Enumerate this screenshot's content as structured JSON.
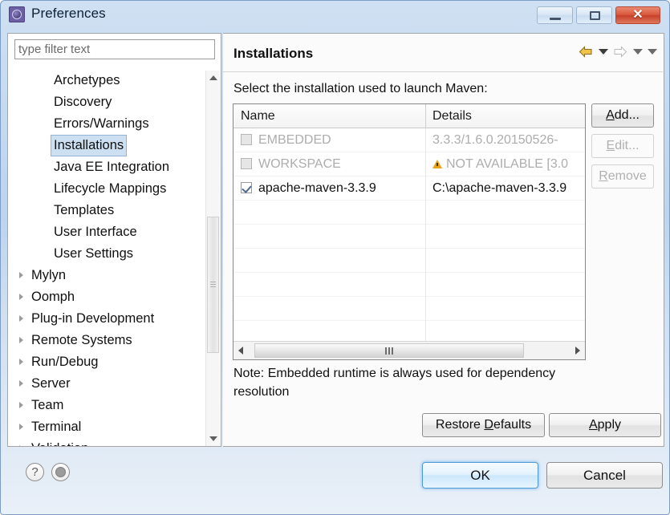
{
  "window": {
    "title": "Preferences",
    "icon": "preferences-gear-icon",
    "controls": {
      "minimize": "minimize-icon",
      "maximize": "maximize-icon",
      "close": "✕"
    }
  },
  "sidebar": {
    "filter": {
      "placeholder": "type filter text",
      "value": ""
    },
    "items": [
      {
        "label": "Archetypes",
        "type": "leaf",
        "selected": false
      },
      {
        "label": "Discovery",
        "type": "leaf",
        "selected": false
      },
      {
        "label": "Errors/Warnings",
        "type": "leaf",
        "selected": false
      },
      {
        "label": "Installations",
        "type": "leaf",
        "selected": true
      },
      {
        "label": "Java EE Integration",
        "type": "leaf",
        "selected": false
      },
      {
        "label": "Lifecycle Mappings",
        "type": "leaf",
        "selected": false
      },
      {
        "label": "Templates",
        "type": "leaf",
        "selected": false
      },
      {
        "label": "User Interface",
        "type": "leaf",
        "selected": false
      },
      {
        "label": "User Settings",
        "type": "leaf",
        "selected": false
      },
      {
        "label": "Mylyn",
        "type": "node",
        "selected": false
      },
      {
        "label": "Oomph",
        "type": "node",
        "selected": false
      },
      {
        "label": "Plug-in Development",
        "type": "node",
        "selected": false
      },
      {
        "label": "Remote Systems",
        "type": "node",
        "selected": false
      },
      {
        "label": "Run/Debug",
        "type": "node",
        "selected": false
      },
      {
        "label": "Server",
        "type": "node",
        "selected": false
      },
      {
        "label": "Team",
        "type": "node",
        "selected": false
      },
      {
        "label": "Terminal",
        "type": "node",
        "selected": false
      },
      {
        "label": "Validation",
        "type": "node",
        "selected": false
      }
    ]
  },
  "content": {
    "title": "Installations",
    "instruction": "Select the installation used to launch Maven:",
    "nav": {
      "back": "back-arrow-icon",
      "back_menu": "chevron-down-icon",
      "forward": "forward-arrow-icon",
      "forward_menu": "chevron-down-icon",
      "view_menu": "chevron-down-icon"
    },
    "table": {
      "columns": [
        "Name",
        "Details"
      ],
      "rows": [
        {
          "checked": false,
          "enabled": false,
          "warning": false,
          "name": "EMBEDDED",
          "details": "3.3.3/1.6.0.20150526-"
        },
        {
          "checked": false,
          "enabled": false,
          "warning": true,
          "name": "WORKSPACE",
          "details": "NOT AVAILABLE [3.0"
        },
        {
          "checked": true,
          "enabled": true,
          "warning": false,
          "name": "apache-maven-3.3.9",
          "details": "C:\\apache-maven-3.3.9"
        }
      ],
      "empty_rows": 6
    },
    "side_buttons": [
      {
        "label": "Add...",
        "mnemonic": "A",
        "enabled": true
      },
      {
        "label": "Edit...",
        "mnemonic": "E",
        "enabled": false
      },
      {
        "label": "Remove",
        "mnemonic": "R",
        "enabled": false
      }
    ],
    "note": "Note: Embedded runtime is always used for dependency resolution",
    "restore_defaults": "Restore Defaults",
    "restore_defaults_mnemonic": "D",
    "apply": "Apply",
    "apply_mnemonic": "A"
  },
  "footer": {
    "help_icon": "?",
    "extra_icon": "info-circle-icon",
    "ok": "OK",
    "cancel": "Cancel"
  },
  "colors": {
    "titlebar_top": "#cfe0f2",
    "selection": "#cde0f2",
    "selection_border": "#93b4d4",
    "close_button": "#d9563a",
    "default_button_border": "#4e9bd4",
    "warning": "#e8a317",
    "disabled_text": "#adadad"
  }
}
